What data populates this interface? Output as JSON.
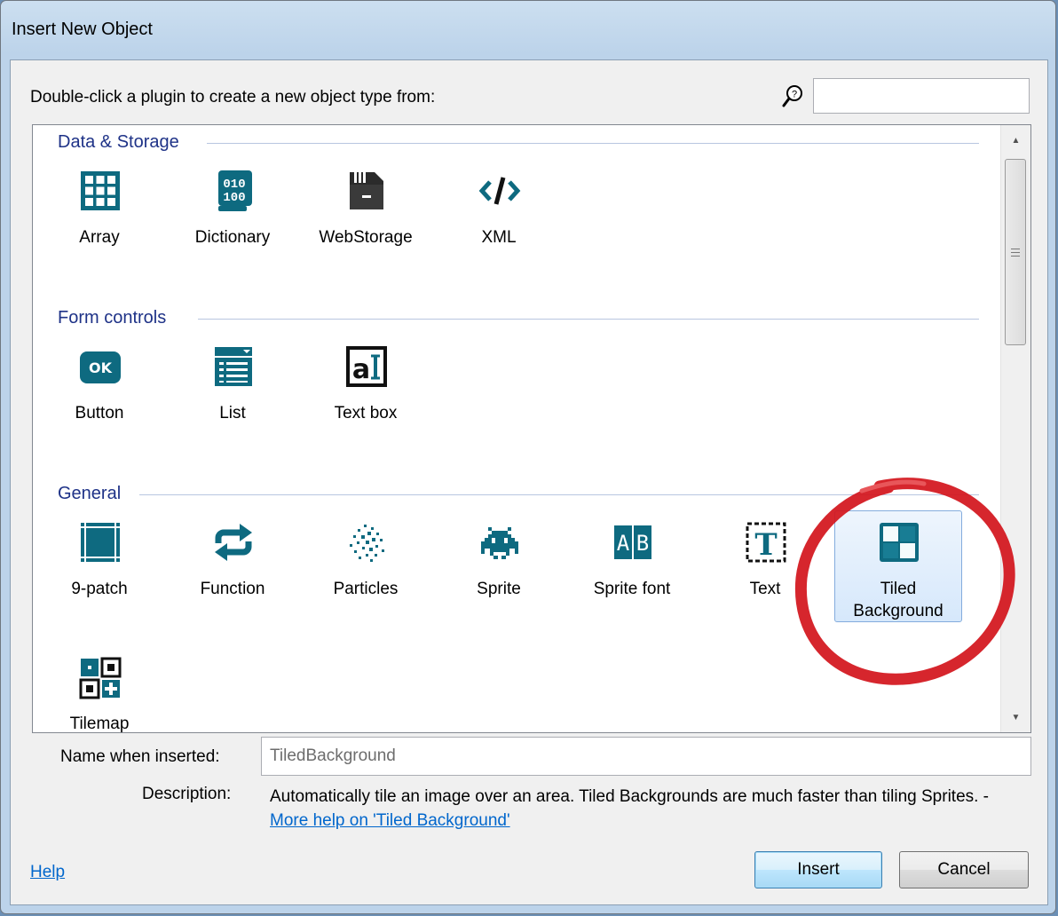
{
  "window": {
    "title": "Insert New Object"
  },
  "header": {
    "instruction": "Double-click a plugin to create a new object type from:",
    "search": {
      "value": "",
      "placeholder": ""
    }
  },
  "categories": [
    {
      "name": "Data & Storage",
      "items": [
        {
          "label": "Array",
          "icon": "grid-icon"
        },
        {
          "label": "Dictionary",
          "icon": "binary-document-icon"
        },
        {
          "label": "WebStorage",
          "icon": "storage-drive-icon"
        },
        {
          "label": "XML",
          "icon": "code-tag-icon"
        }
      ]
    },
    {
      "name": "Form controls",
      "items": [
        {
          "label": "Button",
          "icon": "ok-button-icon",
          "icon_text": "OK"
        },
        {
          "label": "List",
          "icon": "list-icon"
        },
        {
          "label": "Text box",
          "icon": "textbox-icon",
          "icon_text": "a"
        }
      ]
    },
    {
      "name": "General",
      "items": [
        {
          "label": "9-patch",
          "icon": "nine-patch-icon"
        },
        {
          "label": "Function",
          "icon": "repeat-arrows-icon"
        },
        {
          "label": "Particles",
          "icon": "particles-icon"
        },
        {
          "label": "Sprite",
          "icon": "space-invader-icon"
        },
        {
          "label": "Sprite font",
          "icon": "sprite-font-icon",
          "icon_text": "AB"
        },
        {
          "label": "Text",
          "icon": "text-t-icon",
          "icon_text": "T"
        },
        {
          "label": "Tiled Background",
          "label_line1": "Tiled",
          "label_line2": "Background",
          "icon": "tiled-background-icon",
          "selected": true
        },
        {
          "label": "Tilemap",
          "icon": "tilemap-icon"
        }
      ]
    }
  ],
  "footer": {
    "name_label": "Name when inserted:",
    "name_value": "TiledBackground",
    "description_label": "Description:",
    "description_text": "Automatically tile an image over an area.  Tiled Backgrounds are much faster than tiling Sprites. - ",
    "description_link": "More help on 'Tiled Background'",
    "help_link": "Help",
    "insert_label": "Insert",
    "cancel_label": "Cancel"
  },
  "colors": {
    "icon_teal": "#0e6a80",
    "category_text": "#1e3287",
    "highlight_circle": "#d3141b",
    "selection_border": "#84acdd"
  }
}
